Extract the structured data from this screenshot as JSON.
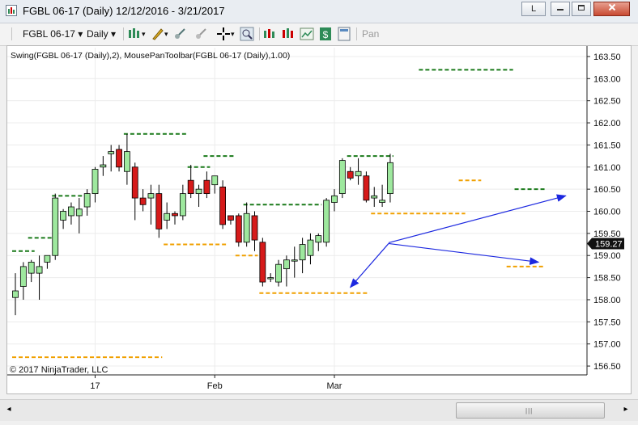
{
  "window": {
    "title": "FGBL 06-17 (Daily)  12/12/2016 - 3/21/2017",
    "buttons": {
      "minimize": "L",
      "restore": "□",
      "close": "✕"
    }
  },
  "toolbar": {
    "instrument": "FGBL 06-17",
    "period": "Daily",
    "pan_label": "Pan"
  },
  "chart_data": {
    "type": "candlestick",
    "indicator_label": "Swing(FGBL 06-17 (Daily),2), MousePanToolbar(FGBL 06-17 (Daily),1.00)",
    "copyright": "© 2017 NinjaTrader, LLC",
    "last_price": "159.27",
    "ylim": [
      156.3,
      163.7
    ],
    "y_ticks": [
      "163.50",
      "163.00",
      "162.50",
      "162.00",
      "161.50",
      "161.00",
      "160.50",
      "160.00",
      "159.50",
      "159.00",
      "158.50",
      "158.00",
      "157.50",
      "157.00",
      "156.50"
    ],
    "x_ticks": [
      {
        "label": "17",
        "bar": 10
      },
      {
        "label": "Feb",
        "bar": 25
      },
      {
        "label": "Mar",
        "bar": 40
      }
    ],
    "bars": [
      {
        "o": 158.05,
        "h": 158.6,
        "l": 157.65,
        "c": 158.2
      },
      {
        "o": 158.3,
        "h": 158.85,
        "l": 158.0,
        "c": 158.75
      },
      {
        "o": 158.6,
        "h": 158.9,
        "l": 158.4,
        "c": 158.85
      },
      {
        "o": 158.6,
        "h": 159.0,
        "l": 158.0,
        "c": 158.75
      },
      {
        "o": 158.85,
        "h": 159.0,
        "l": 158.7,
        "c": 159.0
      },
      {
        "o": 159.0,
        "h": 160.4,
        "l": 158.9,
        "c": 160.3
      },
      {
        "o": 159.8,
        "h": 160.05,
        "l": 159.6,
        "c": 160.0
      },
      {
        "o": 159.9,
        "h": 160.2,
        "l": 159.7,
        "c": 160.1
      },
      {
        "o": 159.9,
        "h": 160.3,
        "l": 159.5,
        "c": 160.05
      },
      {
        "o": 160.1,
        "h": 160.5,
        "l": 159.9,
        "c": 160.4
      },
      {
        "o": 160.4,
        "h": 161.0,
        "l": 160.2,
        "c": 160.95
      },
      {
        "o": 161.0,
        "h": 161.25,
        "l": 160.8,
        "c": 161.05
      },
      {
        "o": 161.3,
        "h": 161.5,
        "l": 160.9,
        "c": 161.35
      },
      {
        "o": 161.4,
        "h": 161.5,
        "l": 160.9,
        "c": 161.0
      },
      {
        "o": 160.9,
        "h": 161.75,
        "l": 160.6,
        "c": 161.35
      },
      {
        "o": 161.0,
        "h": 161.1,
        "l": 159.8,
        "c": 160.3
      },
      {
        "o": 160.3,
        "h": 160.5,
        "l": 160.0,
        "c": 160.15
      },
      {
        "o": 160.3,
        "h": 160.6,
        "l": 159.7,
        "c": 160.4
      },
      {
        "o": 160.4,
        "h": 160.6,
        "l": 159.4,
        "c": 159.6
      },
      {
        "o": 159.8,
        "h": 160.2,
        "l": 159.6,
        "c": 159.95
      },
      {
        "o": 159.95,
        "h": 160.0,
        "l": 159.7,
        "c": 159.9
      },
      {
        "o": 159.9,
        "h": 160.6,
        "l": 159.8,
        "c": 160.4
      },
      {
        "o": 160.7,
        "h": 161.05,
        "l": 160.3,
        "c": 160.4
      },
      {
        "o": 160.4,
        "h": 160.6,
        "l": 160.1,
        "c": 160.5
      },
      {
        "o": 160.7,
        "h": 160.9,
        "l": 160.3,
        "c": 160.4
      },
      {
        "o": 160.6,
        "h": 160.8,
        "l": 160.4,
        "c": 160.8
      },
      {
        "o": 160.55,
        "h": 160.7,
        "l": 159.6,
        "c": 159.7
      },
      {
        "o": 159.9,
        "h": 159.9,
        "l": 159.7,
        "c": 159.8
      },
      {
        "o": 159.9,
        "h": 159.95,
        "l": 159.2,
        "c": 159.3
      },
      {
        "o": 159.3,
        "h": 160.2,
        "l": 159.2,
        "c": 159.95
      },
      {
        "o": 159.9,
        "h": 160.0,
        "l": 159.1,
        "c": 159.35
      },
      {
        "o": 159.3,
        "h": 159.4,
        "l": 158.3,
        "c": 158.4
      },
      {
        "o": 158.5,
        "h": 158.6,
        "l": 158.4,
        "c": 158.5
      },
      {
        "o": 158.4,
        "h": 158.9,
        "l": 158.3,
        "c": 158.8
      },
      {
        "o": 158.7,
        "h": 159.0,
        "l": 158.3,
        "c": 158.9
      },
      {
        "o": 158.9,
        "h": 159.2,
        "l": 158.5,
        "c": 158.9
      },
      {
        "o": 158.9,
        "h": 159.4,
        "l": 158.6,
        "c": 159.25
      },
      {
        "o": 159.0,
        "h": 159.5,
        "l": 158.8,
        "c": 159.35
      },
      {
        "o": 159.3,
        "h": 159.5,
        "l": 159.1,
        "c": 159.45
      },
      {
        "o": 159.3,
        "h": 160.3,
        "l": 159.2,
        "c": 160.25
      },
      {
        "o": 160.2,
        "h": 160.5,
        "l": 160.0,
        "c": 160.35
      },
      {
        "o": 160.4,
        "h": 161.2,
        "l": 160.3,
        "c": 161.15
      },
      {
        "o": 160.9,
        "h": 161.0,
        "l": 160.7,
        "c": 160.75
      },
      {
        "o": 160.8,
        "h": 161.2,
        "l": 160.6,
        "c": 160.9
      },
      {
        "o": 160.8,
        "h": 160.9,
        "l": 160.2,
        "c": 160.25
      },
      {
        "o": 160.3,
        "h": 160.55,
        "l": 160.1,
        "c": 160.35
      },
      {
        "o": 160.2,
        "h": 160.6,
        "l": 160.1,
        "c": 160.25
      },
      {
        "o": 160.4,
        "h": 161.3,
        "l": 160.2,
        "c": 161.1
      }
    ],
    "swing_highs": [
      {
        "price": 159.1,
        "from": 0,
        "to": 2
      },
      {
        "price": 159.4,
        "from": 2,
        "to": 5
      },
      {
        "price": 160.35,
        "from": 5,
        "to": 9
      },
      {
        "price": 161.75,
        "from": 14,
        "to": 21
      },
      {
        "price": 161.0,
        "from": 22,
        "to": 24
      },
      {
        "price": 161.25,
        "from": 24,
        "to": 27
      },
      {
        "price": 160.15,
        "from": 29,
        "to": 38
      },
      {
        "price": 161.25,
        "from": 42,
        "to": 47
      },
      {
        "price": 163.2,
        "from": 51,
        "to": 62
      },
      {
        "price": 160.5,
        "from": 63,
        "to": 66
      }
    ],
    "swing_lows": [
      {
        "price": 156.7,
        "from": 0,
        "to": 18
      },
      {
        "price": 159.25,
        "from": 19,
        "to": 26
      },
      {
        "price": 159.0,
        "from": 28,
        "to": 30
      },
      {
        "price": 158.15,
        "from": 31,
        "to": 44
      },
      {
        "price": 159.95,
        "from": 45,
        "to": 56
      },
      {
        "price": 160.7,
        "from": 56,
        "to": 58
      },
      {
        "price": 158.75,
        "from": 62,
        "to": 66
      }
    ]
  }
}
